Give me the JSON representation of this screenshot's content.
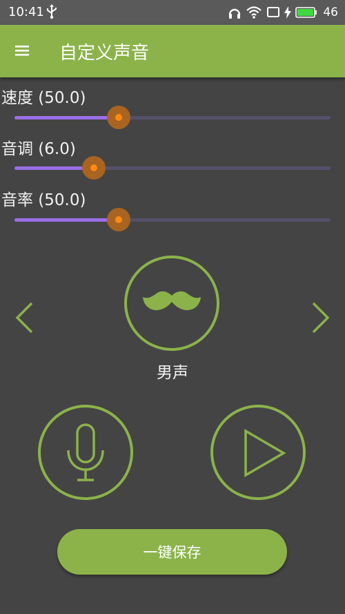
{
  "status_bar": {
    "time": "10:41",
    "battery_level": "46",
    "icons": [
      "usb-icon",
      "headphones-icon",
      "wifi-icon",
      "screen-icon",
      "charging-icon",
      "battery-icon"
    ]
  },
  "app_bar": {
    "title": "自定义声音",
    "menu_icon": "hamburger-menu-icon"
  },
  "sliders": [
    {
      "label": "速度 (50.0)",
      "value_fraction": 0.33
    },
    {
      "label": "音调 (6.0)",
      "value_fraction": 0.25
    },
    {
      "label": "音率 (50.0)",
      "value_fraction": 0.33
    }
  ],
  "voice": {
    "name": "男声",
    "icon": "mustache-icon",
    "prev_icon": "chevron-left-icon",
    "next_icon": "chevron-right-icon"
  },
  "actions": {
    "record_icon": "microphone-icon",
    "play_icon": "play-icon"
  },
  "save_button": {
    "label": "一键保存"
  },
  "colors": {
    "accent_green": "#8bb34a",
    "background": "#444444",
    "slider_fill": "#9b6ee8",
    "slider_thumb": "#ff8a12"
  }
}
